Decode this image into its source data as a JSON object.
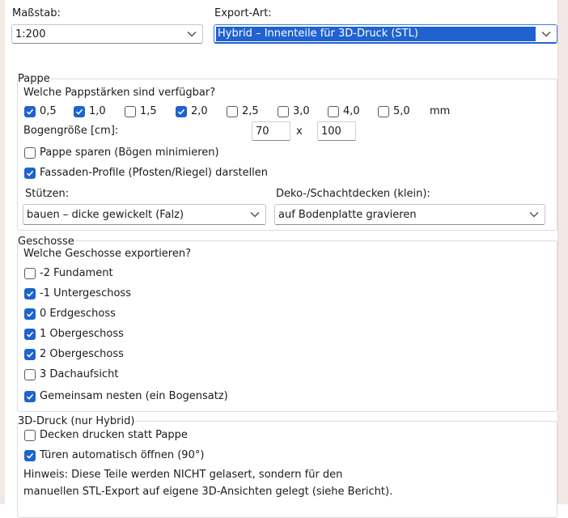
{
  "massstab": {
    "label": "Maßstab:",
    "value": "1:200"
  },
  "export": {
    "label": "Export-Art:",
    "value": "Hybrid – Innenteile für 3D-Druck (STL)"
  },
  "pappe": {
    "title": "Pappe",
    "question": "Welche Pappstärken sind verfügbar?",
    "thicknesses": [
      {
        "label": "0,5",
        "checked": true
      },
      {
        "label": "1,0",
        "checked": true
      },
      {
        "label": "1,5",
        "checked": false
      },
      {
        "label": "2,0",
        "checked": true
      },
      {
        "label": "2,5",
        "checked": false
      },
      {
        "label": "3,0",
        "checked": false
      },
      {
        "label": "4,0",
        "checked": false
      },
      {
        "label": "5,0",
        "checked": false
      }
    ],
    "unit": "mm",
    "sheet_label": "Bogengröße [cm]:",
    "sheet_width": "70",
    "sheet_sep": "x",
    "sheet_height": "100",
    "save_paper": {
      "label": "Pappe sparen (Bögen minimieren)",
      "checked": false
    },
    "facade_profiles": {
      "label": "Fassaden-Profile (Pfosten/Riegel) darstellen",
      "checked": true
    },
    "supports": {
      "label": "Stützen:",
      "value": "bauen – dicke gewickelt (Falz)"
    },
    "ceilings": {
      "label": "Deko-/Schachtdecken (klein):",
      "value": "auf Bodenplatte gravieren"
    }
  },
  "geschosse": {
    "title": "Geschosse",
    "question": "Welche Geschosse exportieren?",
    "floors": [
      {
        "label": "-2 Fundament",
        "checked": false
      },
      {
        "label": "-1 Untergeschoss",
        "checked": true
      },
      {
        "label": "0 Erdgeschoss",
        "checked": true
      },
      {
        "label": "1 Obergeschoss",
        "checked": true
      },
      {
        "label": "2 Obergeschoss",
        "checked": true
      },
      {
        "label": "3 Dachaufsicht",
        "checked": false
      }
    ],
    "nest": {
      "label": "Gemeinsam nesten (ein Bogensatz)",
      "checked": true
    }
  },
  "druck": {
    "title": "3D-Druck (nur Hybrid)",
    "print_ceilings": {
      "label": "Decken drucken statt Pappe",
      "checked": false
    },
    "open_doors": {
      "label": "Türen automatisch öffnen (90°)",
      "checked": true
    },
    "hint_line1": "Hinweis: Diese Teile werden NICHT gelasert, sondern für den",
    "hint_line2": "manuellen STL-Export auf eigene 3D-Ansichten gelegt (siehe Bericht)."
  },
  "colors": {
    "accent": "#1f62d0",
    "window_frame": "#f3e9e4",
    "group_border": "#dcdcdc"
  }
}
